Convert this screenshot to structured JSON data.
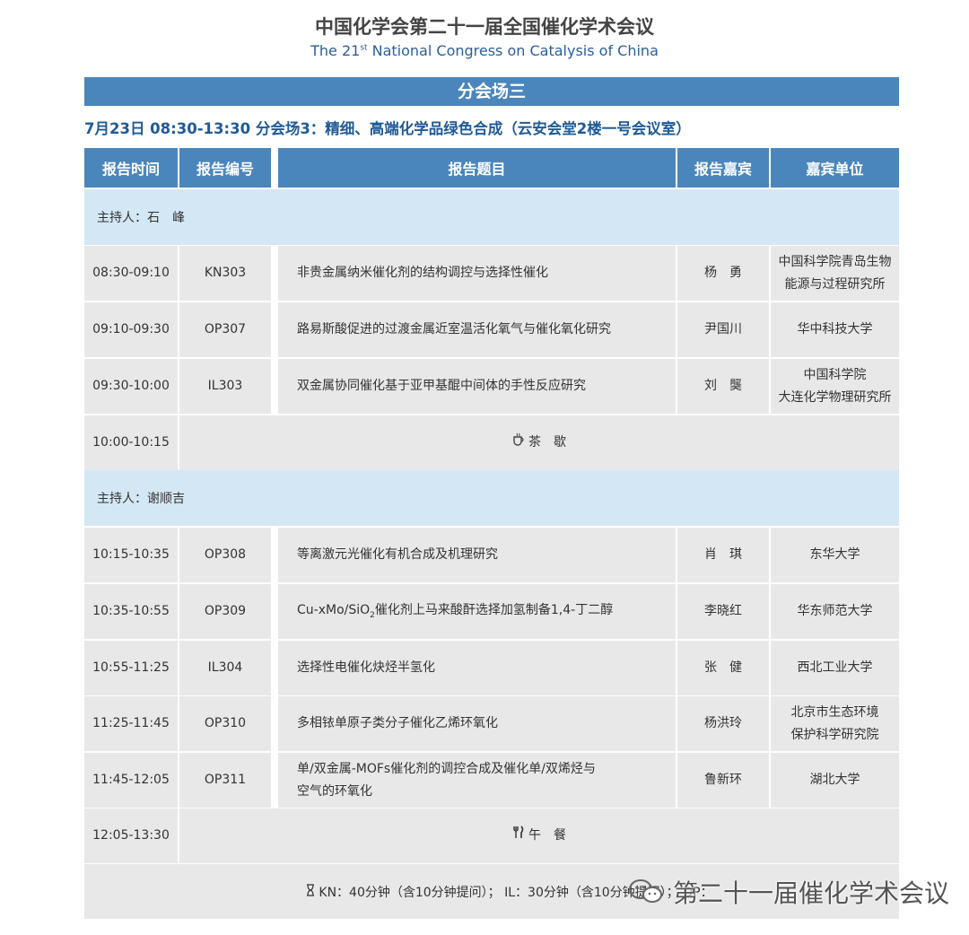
{
  "header": {
    "title_cn": "中国化学会第二十一届全国催化学术会议",
    "title_en_prefix": "The 21",
    "title_en_sup": "st",
    "title_en_suffix": " National Congress on Catalysis of China"
  },
  "section": {
    "title": "分会场三"
  },
  "session": {
    "line": "7月23日  08:30-13:30  分会场3：精细、高端化学品绿色合成（云安会堂2楼一号会议室）"
  },
  "columns": [
    "报告时间",
    "报告编号",
    "报告题目",
    "报告嘉宾",
    "嘉宾单位"
  ],
  "hosts": [
    {
      "label": "主持人：石　峰"
    },
    {
      "label": "主持人：谢顺吉"
    }
  ],
  "rows": [
    {
      "time": "08:30-09:10",
      "code": "KN303",
      "topic": "非贵金属纳米催化剂的结构调控与选择性催化",
      "speaker": "杨　勇",
      "affil_1": "中国科学院青岛生物",
      "affil_2": "能源与过程研究所"
    },
    {
      "time": "09:10-09:30",
      "code": "OP307",
      "topic": "路易斯酸促进的过渡金属近室温活化氧气与催化氧化研究",
      "speaker": "尹国川",
      "affil_1": "华中科技大学",
      "affil_2": ""
    },
    {
      "time": "09:30-10:00",
      "code": "IL303",
      "topic": "双金属协同催化基于亚甲基醌中间体的手性反应研究",
      "speaker": "刘　龑",
      "affil_1": "中国科学院",
      "affil_2": "大连化学物理研究所"
    },
    {
      "time": "10:15-10:35",
      "code": "OP308",
      "topic": "等离激元光催化有机合成及机理研究",
      "speaker": "肖　琪",
      "affil_1": "东华大学",
      "affil_2": ""
    },
    {
      "time": "10:35-10:55",
      "code": "OP309",
      "topic_pre": "Cu-xMo/SiO",
      "topic_sub": "2",
      "topic_post": "催化剂上马来酸酐选择加氢制备1,4-丁二醇",
      "speaker": "李晓红",
      "affil_1": "华东师范大学",
      "affil_2": ""
    },
    {
      "time": "10:55-11:25",
      "code": "IL304",
      "topic": "选择性电催化炔烃半氢化",
      "speaker": "张　健",
      "affil_1": "西北工业大学",
      "affil_2": ""
    },
    {
      "time": "11:25-11:45",
      "code": "OP310",
      "topic": "多相铱单原子类分子催化乙烯环氧化",
      "speaker": "杨洪玲",
      "affil_1": "北京市生态环境",
      "affil_2": "保护科学研究院"
    },
    {
      "time": "11:45-12:05",
      "code": "OP311",
      "topic_1": "单/双金属-MOFs催化剂的调控合成及催化单/双烯烃与",
      "topic_2": "空气的环氧化",
      "speaker": "鲁新环",
      "affil_1": "湖北大学",
      "affil_2": ""
    }
  ],
  "breaks": [
    {
      "time": "10:00-10:15",
      "label": "茶　歇",
      "icon": "tea-cup-icon"
    },
    {
      "time": "12:05-13:30",
      "label": "午　餐",
      "icon": "fork-knife-icon"
    }
  ],
  "footer": {
    "icon": "hourglass-icon",
    "text": "KN：40分钟（含10分钟提问）；  IL：30分钟（含10分钟提问）；  OP："
  },
  "watermark": {
    "text": "第二十一届催化学术会议",
    "icon": "wechat-icon"
  },
  "colors": {
    "header_blue": "#4a86bc",
    "host_bg": "#d4e7f4",
    "cell_bg": "#e8e8e8",
    "session_text": "#1f5a96"
  }
}
